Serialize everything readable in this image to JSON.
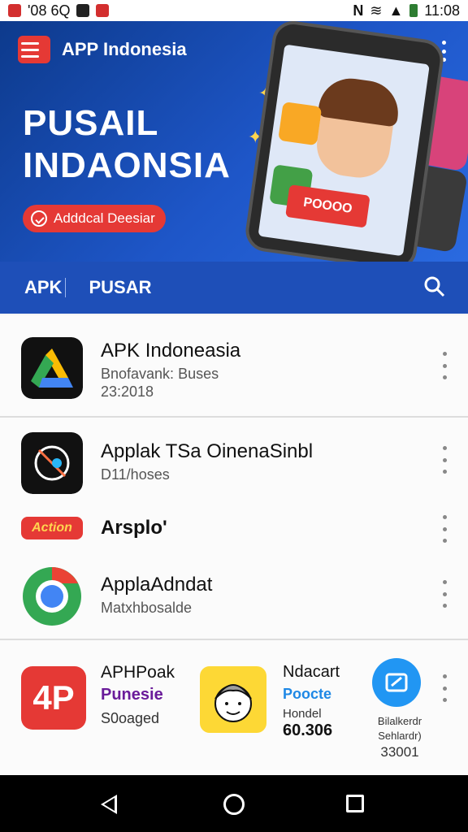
{
  "status_bar": {
    "left_text": "'08 6Q",
    "time": "11:08"
  },
  "app_bar": {
    "title": "APP Indonesia"
  },
  "hero": {
    "title_line1": "PUSAIL",
    "title_line2": "INDAONSIA",
    "cta_label": "Adddcal Deesiar",
    "phone_banner": "POOOO"
  },
  "tabs": {
    "tab1": "APK",
    "tab2": "PUSAR"
  },
  "list": {
    "items": [
      {
        "title": "APK Indoneasia",
        "subtitle": "Bnofavank: Buses",
        "meta": "23:2018"
      },
      {
        "title": "Applak TSa OinenaSinbl",
        "subtitle": "D11/hoses"
      },
      {
        "title": "Arsplo'",
        "badge": "Action"
      },
      {
        "title": "ApplaAdndat",
        "subtitle": "Matxhbosalde"
      }
    ],
    "grid": [
      {
        "title": "APHPoak",
        "subtitle": "Punesie",
        "meta": "S0oaged",
        "icon_text": "4P"
      },
      {
        "title": "Ndacart",
        "subtitle": "Poocte",
        "meta": "Hondel",
        "value": "60.306"
      },
      {
        "title": "Bilalkerdr",
        "subtitle": "Sehlardr)",
        "meta": "33001"
      }
    ]
  },
  "colors": {
    "brand_red": "#e53935",
    "brand_blue": "#1e4fb8"
  }
}
